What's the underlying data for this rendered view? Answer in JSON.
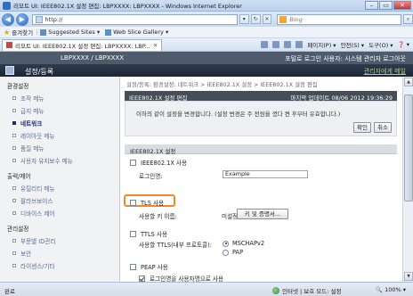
{
  "browser": {
    "window_title": "리모트 UI: IEEE802.1X 설정 편집: LBPXXXX: LBPXXXX - Windows Internet Explorer",
    "url": "http://",
    "search_placeholder": "Bing",
    "favorites_label": "즐겨찾기",
    "favorites_items": [
      "Suggested Sites ▾",
      "Web Slice Gallery ▾"
    ],
    "tab_label": "리모트 UI: IEEE802.1X 설정 편집: LBPXXXX: LBP...",
    "command_bar": [
      "페이지(P) ▾",
      "안전(S) ▾",
      "도구(O) ▾",
      "❓ ▾"
    ],
    "window_buttons": [
      "–",
      "▭",
      "✕"
    ]
  },
  "header": {
    "model": "LBPXXXX / LBPXXXX",
    "login_info": "포털로 로그인 사용자: 시스템 관리자 로그아웃",
    "home_title": "설정/등록",
    "manager_menu": "관리자에게 메일"
  },
  "sidebar": {
    "groups": [
      {
        "label": "환경설정",
        "items": [
          {
            "label": "조작 메뉴",
            "active": false
          },
          {
            "label": "급지 메뉴",
            "active": false
          },
          {
            "label": "네트워크",
            "active": true
          },
          {
            "label": "레이아웃 메뉴",
            "active": false
          },
          {
            "label": "품질 메뉴",
            "active": false
          },
          {
            "label": "사용자 유지보수 메뉴",
            "active": false
          }
        ]
      },
      {
        "label": "출력/제어",
        "items": [
          {
            "label": "유틸리티 메뉴",
            "active": false
          },
          {
            "label": "팔라브보이스",
            "active": false
          },
          {
            "label": "디바이스 제어",
            "active": false
          }
        ]
      },
      {
        "label": "관리설정",
        "items": [
          {
            "label": "부문별 ID관리",
            "active": false
          },
          {
            "label": "보안",
            "active": false
          },
          {
            "label": "라이센스/기타",
            "active": false
          }
        ]
      }
    ]
  },
  "main": {
    "breadcrumb": "설정/등록: 환경설정: 네트워크 > IEEE802.1X 설정 > IEEE802.1X 설정 편집",
    "edit_title": "IEEE802.1X 설정 편집",
    "last_updated": "마지막 업데이트 08/06 2012 19:36:29",
    "notice": "이하의 같이 설정을 변경합니다. (설정 변경은 주 전원을 껐다 켠 후부터 유효합니다.)",
    "ok_button": "확인",
    "cancel_button": "취소",
    "section_title": "IEEE802.1X 설정",
    "ieee_use_label": "IEEE802.1X 사용",
    "login_name_label": "로그인명:",
    "login_name_value": "Example",
    "tls_label": "TLS 사용",
    "key_name_label": "사용할 키 이름:",
    "key_status": "미설정",
    "key_button": "키 및 증명서...",
    "ttls_label": "TTLS 사용",
    "ttls_protocol_label": "사용할 TTLS(내부 프로토콜):",
    "ttls_options": [
      "MSCHAPv2",
      "PAP"
    ],
    "peap_label": "PEAP 사용",
    "use_login_as_user": "로그인명을 사용자명으로 사용"
  },
  "status": {
    "done": "완료",
    "zone": "인터넷 | 보호 모드: 설정",
    "zoom": "🔍 100% ▾"
  }
}
